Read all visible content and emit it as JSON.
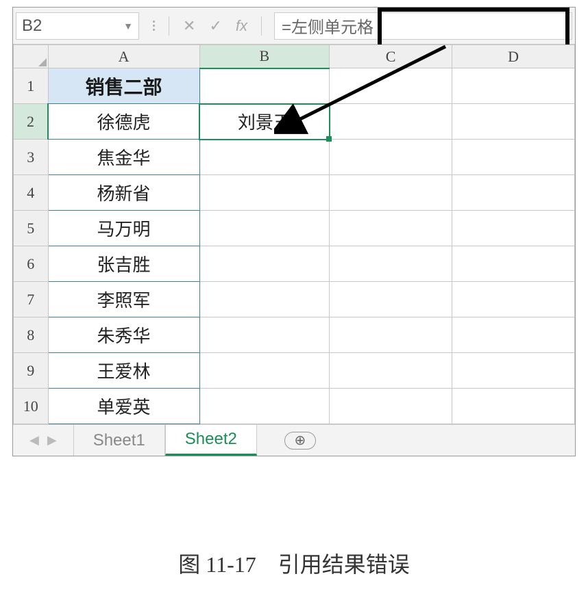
{
  "formula_bar": {
    "name_box": "B2",
    "formula": "=左侧单元格",
    "fx_label": "fx"
  },
  "columns": [
    "A",
    "B",
    "C",
    "D"
  ],
  "rows": [
    "1",
    "2",
    "3",
    "4",
    "5",
    "6",
    "7",
    "8",
    "9",
    "10"
  ],
  "data": {
    "A1": "销售二部",
    "A2": "徐德虎",
    "A3": "焦金华",
    "A4": "杨新省",
    "A5": "马万明",
    "A6": "张吉胜",
    "A7": "李照军",
    "A8": "朱秀华",
    "A9": "王爱林",
    "A10": "单爱英",
    "B2": "刘景玉"
  },
  "active_cell": "B2",
  "sheets": {
    "tabs": [
      "Sheet1",
      "Sheet2"
    ],
    "active": "Sheet2"
  },
  "caption": "图 11-17　引用结果错误",
  "icons": {
    "cancel": "✕",
    "confirm": "✓",
    "plus": "⊕",
    "nav_prev": "◀",
    "nav_next": "▶"
  }
}
